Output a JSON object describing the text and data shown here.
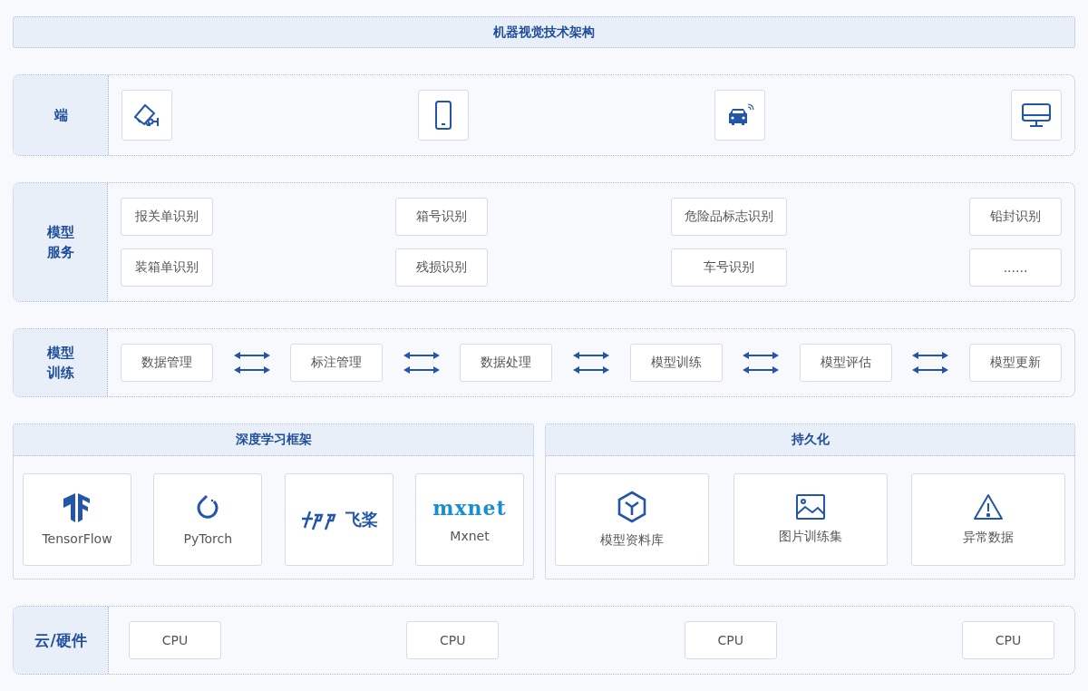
{
  "title": "机器视觉技术架构",
  "endpoints": {
    "label": "端",
    "devices": [
      {
        "kind": "camera"
      },
      {
        "kind": "phone"
      },
      {
        "kind": "car"
      },
      {
        "kind": "monitor"
      }
    ]
  },
  "model_service": {
    "label": "模型服务",
    "items": [
      "报关单识别",
      "箱号识别",
      "危险品标志识别",
      "铅封识别",
      "装箱单识别",
      "残损识别",
      "车号识别",
      "......"
    ]
  },
  "model_training": {
    "label": "模型训练",
    "steps": [
      "数据管理",
      "标注管理",
      "数据处理",
      "模型训练",
      "模型评估",
      "模型更新"
    ]
  },
  "frameworks": {
    "title": "深度学习框架",
    "items": [
      {
        "kind": "tensorflow",
        "name": "TensorFlow"
      },
      {
        "kind": "pytorch",
        "name": "PyTorch"
      },
      {
        "kind": "paddle",
        "logo_text": "飞桨"
      },
      {
        "kind": "mxnet",
        "logo_text": "mxnet",
        "name": "Mxnet"
      }
    ]
  },
  "persistence": {
    "title": "持久化",
    "items": [
      {
        "kind": "cube",
        "name": "模型资料库"
      },
      {
        "kind": "image",
        "name": "图片训练集"
      },
      {
        "kind": "warning",
        "name": "异常数据"
      }
    ]
  },
  "hardware": {
    "label": "云/硬件",
    "items": [
      "CPU",
      "CPU",
      "CPU",
      "CPU"
    ]
  }
}
